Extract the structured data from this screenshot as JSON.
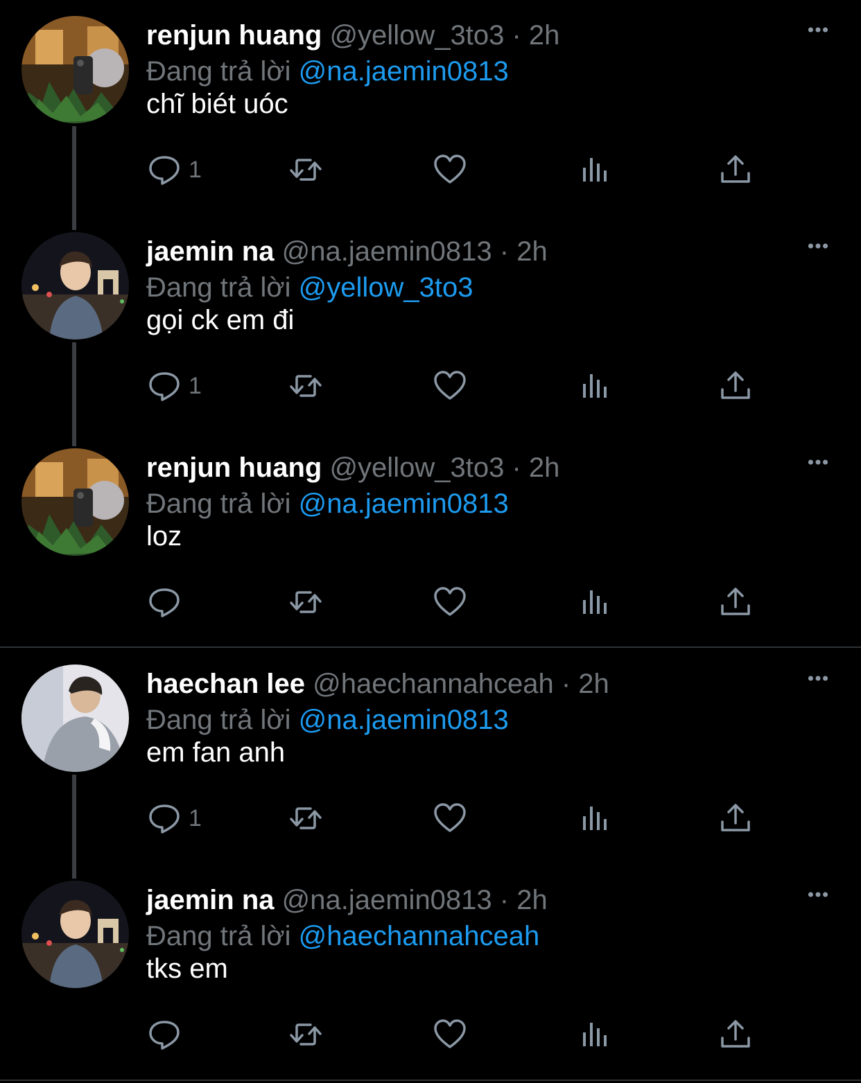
{
  "tweets": [
    {
      "name": "renjun huang",
      "handle": "@yellow_3to3",
      "dot": "·",
      "time": "2h",
      "reply_prefix": "Đang trả lời",
      "reply_to": "@na.jaemin0813",
      "text": "chĩ biét uóc",
      "reply_count": "1",
      "avatar_icon": "avatar-renjun"
    },
    {
      "name": "jaemin na",
      "handle": "@na.jaemin0813",
      "dot": "·",
      "time": "2h",
      "reply_prefix": "Đang trả lời",
      "reply_to": "@yellow_3to3",
      "text": "gọi ck em đi",
      "reply_count": "1",
      "avatar_icon": "avatar-jaemin"
    },
    {
      "name": "renjun huang",
      "handle": "@yellow_3to3",
      "dot": "·",
      "time": "2h",
      "reply_prefix": "Đang trả lời",
      "reply_to": "@na.jaemin0813",
      "text": "loz",
      "reply_count": "",
      "avatar_icon": "avatar-renjun"
    },
    {
      "name": "haechan lee",
      "handle": "@haechannahceah",
      "dot": "·",
      "time": "2h",
      "reply_prefix": "Đang trả lời",
      "reply_to": "@na.jaemin0813",
      "text": "em fan anh",
      "reply_count": "1",
      "avatar_icon": "avatar-haechan"
    },
    {
      "name": "jaemin na",
      "handle": "@na.jaemin0813",
      "dot": "·",
      "time": "2h",
      "reply_prefix": "Đang trả lời",
      "reply_to": "@haechannahceah",
      "text": "tks em",
      "reply_count": "",
      "avatar_icon": "avatar-jaemin"
    }
  ],
  "colors": {
    "background": "#000000",
    "text": "#ffffff",
    "secondary": "#71767b",
    "link": "#1d9bf0",
    "thread_line": "#3a3d41",
    "separator": "#2f3336"
  },
  "icons": [
    "more-icon",
    "reply-icon",
    "retweet-icon",
    "like-icon",
    "views-icon",
    "share-icon"
  ]
}
